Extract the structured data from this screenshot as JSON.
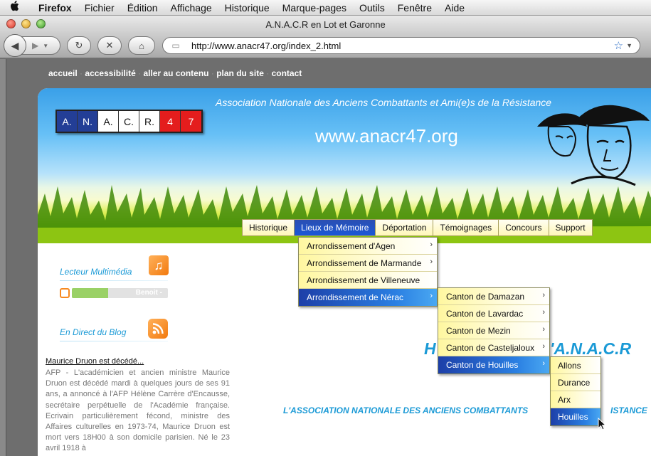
{
  "menubar": {
    "apple": "",
    "items": [
      "Firefox",
      "Fichier",
      "Édition",
      "Affichage",
      "Historique",
      "Marque-pages",
      "Outils",
      "Fenêtre",
      "Aide"
    ]
  },
  "window": {
    "title": "A.N.A.C.R en Lot et Garonne"
  },
  "toolbar": {
    "url": "http://www.anacr47.org/index_2.html"
  },
  "access_links": [
    "accueil",
    "accessibilité",
    "aller au contenu",
    "plan du site",
    "contact"
  ],
  "header": {
    "association": "Association Nationale des Anciens Combattants et Ami(e)s de la Résistance",
    "website": "www.anacr47.org",
    "logo_letters": [
      "A.",
      "N.",
      "A.",
      "C.",
      "R.",
      "4",
      "7"
    ]
  },
  "main_nav": {
    "tabs": [
      "Historique",
      "Lieux de Mémoire",
      "Déportation",
      "Témoignages",
      "Concours",
      "Support"
    ],
    "active_index": 1
  },
  "menu_arrondissements": {
    "items": [
      "Arrondissement d'Agen",
      "Arrondissement de Marmande",
      "Arrondissement de Villeneuve",
      "Arrondissement de Nérac"
    ],
    "has_submenu": [
      true,
      true,
      false,
      true
    ],
    "active_index": 3
  },
  "menu_cantons": {
    "items": [
      "Canton de Damazan",
      "Canton de Lavardac",
      "Canton de Mezin",
      "Canton de Casteljaloux",
      "Canton de Houilles"
    ],
    "active_index": 4
  },
  "menu_communes": {
    "items": [
      "Allons",
      "Durance",
      "Arx",
      "Houilles"
    ],
    "active_index": 3
  },
  "sidebar": {
    "player_title": "Lecteur Multimédia",
    "player_track_name": "Benoit -",
    "player_progress_percent": 38,
    "blog_title": "En Direct du Blog"
  },
  "news": {
    "title": "Maurice Druon est décédé...",
    "body": "AFP - L'académicien et ancien ministre Maurice Druon est décédé mardi à quelques jours de ses 91 ans, a annoncé à l'AFP Hélène Carrère d'Encausse, secrétaire perpétuelle de l'Académie française. Ecrivain particulièrement fécond, ministre des Affaires culturelles en 1973-74, Maurice Druon est mort vers 18H00 à son domicile parisien. Né le 23 avril 1918 à"
  },
  "content": {
    "heading_left": "H",
    "heading_right": "'A.N.A.C.R",
    "assoc_left": "L'ASSOCIATION NATIONALE DES ANCIENS COMBATTANTS",
    "assoc_right": "ISTANCE"
  },
  "colors": {
    "accent_blue": "#1b9ad6",
    "nav_active": "#1a57d8",
    "logo_blue": "#233e96",
    "logo_red": "#e41d1d",
    "grass_green": "#6bae0c"
  },
  "icons": {
    "music": "music-note-icon",
    "rss": "rss-icon"
  }
}
